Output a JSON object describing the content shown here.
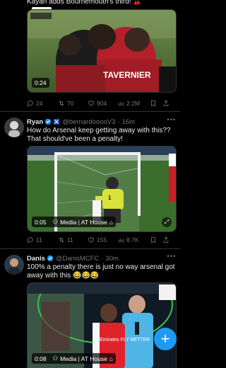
{
  "colors": {
    "background": "#000000",
    "text": "#e7e9ea",
    "muted": "#71767b",
    "accent": "#1d9bf0",
    "divider": "#2f3336"
  },
  "post1": {
    "text_partial": "Kayan adds Bournemouth's third! 🍒",
    "video_time": "0:24",
    "jersey_text": "TAVERNIER",
    "stats": {
      "replies": "24",
      "reposts": "70",
      "likes": "904",
      "views": "2.2M"
    }
  },
  "post2": {
    "name": "Ryan",
    "handle": "@bernardooooV3",
    "time": "16m",
    "text": "How do Arsenal keep getting away with this?? That should've been a penalty!",
    "media_badge": "0:05",
    "media_label": "Media | AT House",
    "stats": {
      "replies": "11",
      "reposts": "11",
      "likes": "155",
      "views": "8.7K"
    }
  },
  "post3": {
    "name": "Danis",
    "handle": "@DanisMCFC",
    "time": "30m",
    "text": "100% a penalty there is just no way arsenal got away with this 😂😂😂",
    "media_badge": "0:08",
    "media_label": "Media | AT House",
    "shirt_text": "Emirates FLY BETTER"
  },
  "icons": [
    "reply-icon",
    "repost-icon",
    "like-icon",
    "views-icon",
    "bookmark-icon",
    "share-icon",
    "verified-icon",
    "compose-icon",
    "more-icon"
  ],
  "fab_label": "+"
}
